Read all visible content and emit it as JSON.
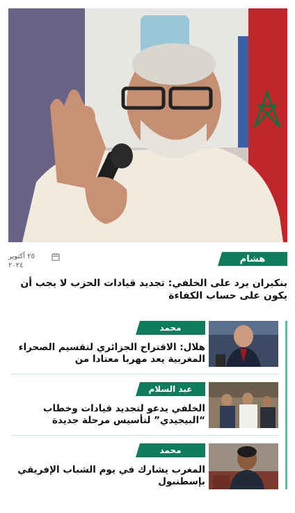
{
  "featured": {
    "author": "هشام",
    "date": "٢٥ أكتوبر ٢٠٢٤",
    "headline": "بنكيران يرد على الخلفي: تجديد قيادات الحزب لا يجب أن يكون على حساب الكفاءة",
    "icons": {
      "date": "calendar-icon"
    }
  },
  "articles": [
    {
      "author": "محمد",
      "title": "هلال: الاقتراح الجزائري لتقسيم الصحراء المغربية يعد مهربا معتادا من"
    },
    {
      "author": "عبد السلام",
      "title": "الخلفي يدعو لتجديد قيادات وخطاب “البيجيدي” لتأسيس مرحلة جديدة"
    },
    {
      "author": "محمد",
      "title": "المغرب يشارك في يوم الشباب الإفريقي بإسطنبول"
    }
  ],
  "colors": {
    "accent": "#0f7d5c",
    "rail": "#5cc0a0"
  }
}
